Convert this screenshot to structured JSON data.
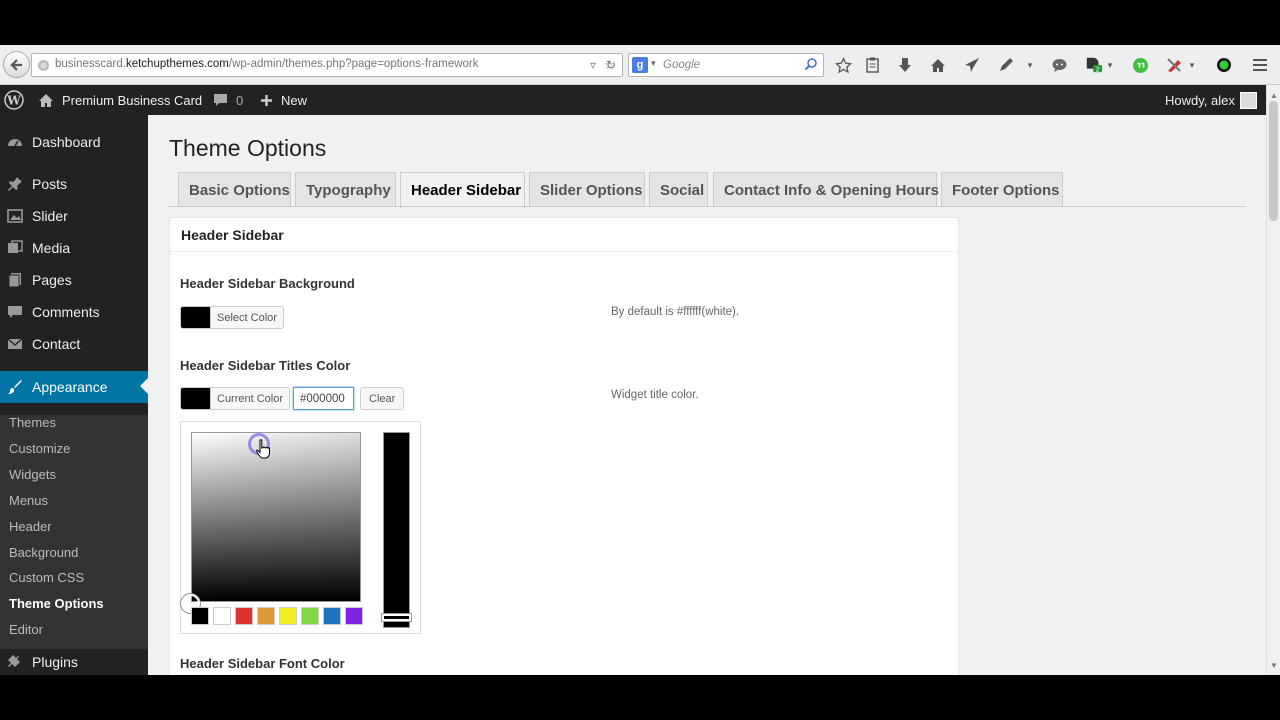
{
  "browser": {
    "url_prefix": "businesscard.",
    "url_domain": "ketchupthemes.com",
    "url_path": "/wp-admin/themes.php?page=options-framework",
    "search_placeholder": "Google",
    "search_engine_letter": "g"
  },
  "adminbar": {
    "site_name": "Premium Business Card",
    "comments_count": "0",
    "new_label": "New",
    "greeting": "Howdy, alex"
  },
  "sidebar": {
    "items": [
      {
        "label": "Dashboard",
        "icon": "dashboard-icon"
      },
      {
        "label": "Posts",
        "icon": "pin-icon"
      },
      {
        "label": "Slider",
        "icon": "slider-icon"
      },
      {
        "label": "Media",
        "icon": "media-icon"
      },
      {
        "label": "Pages",
        "icon": "pages-icon"
      },
      {
        "label": "Comments",
        "icon": "comment-icon"
      },
      {
        "label": "Contact",
        "icon": "mail-icon"
      },
      {
        "label": "Appearance",
        "icon": "paintbrush-icon"
      },
      {
        "label": "Plugins",
        "icon": "plugin-icon"
      }
    ],
    "submenu": [
      "Themes",
      "Customize",
      "Widgets",
      "Menus",
      "Header",
      "Background",
      "Custom CSS",
      "Theme Options",
      "Editor"
    ]
  },
  "main": {
    "title": "Theme Options",
    "tabs": [
      "Basic Options",
      "Typography",
      "Header Sidebar",
      "Slider Options",
      "Social",
      "Contact Info & Opening Hours",
      "Footer Options"
    ],
    "active_tab": "Header Sidebar",
    "panel_title": "Header Sidebar",
    "options": {
      "background": {
        "label": "Header Sidebar Background",
        "button": "Select Color",
        "desc": "By default is #ffffff(white)."
      },
      "titles_color": {
        "label": "Header Sidebar Titles Color",
        "button": "Current Color",
        "value": "#000000",
        "clear": "Clear",
        "desc": "Widget title color."
      },
      "font_color": {
        "label": "Header Sidebar Font Color"
      }
    },
    "palette": [
      "#000000",
      "#ffffff",
      "#dd3333",
      "#dd9933",
      "#eeee22",
      "#81d742",
      "#1e73be",
      "#8224e3"
    ]
  }
}
